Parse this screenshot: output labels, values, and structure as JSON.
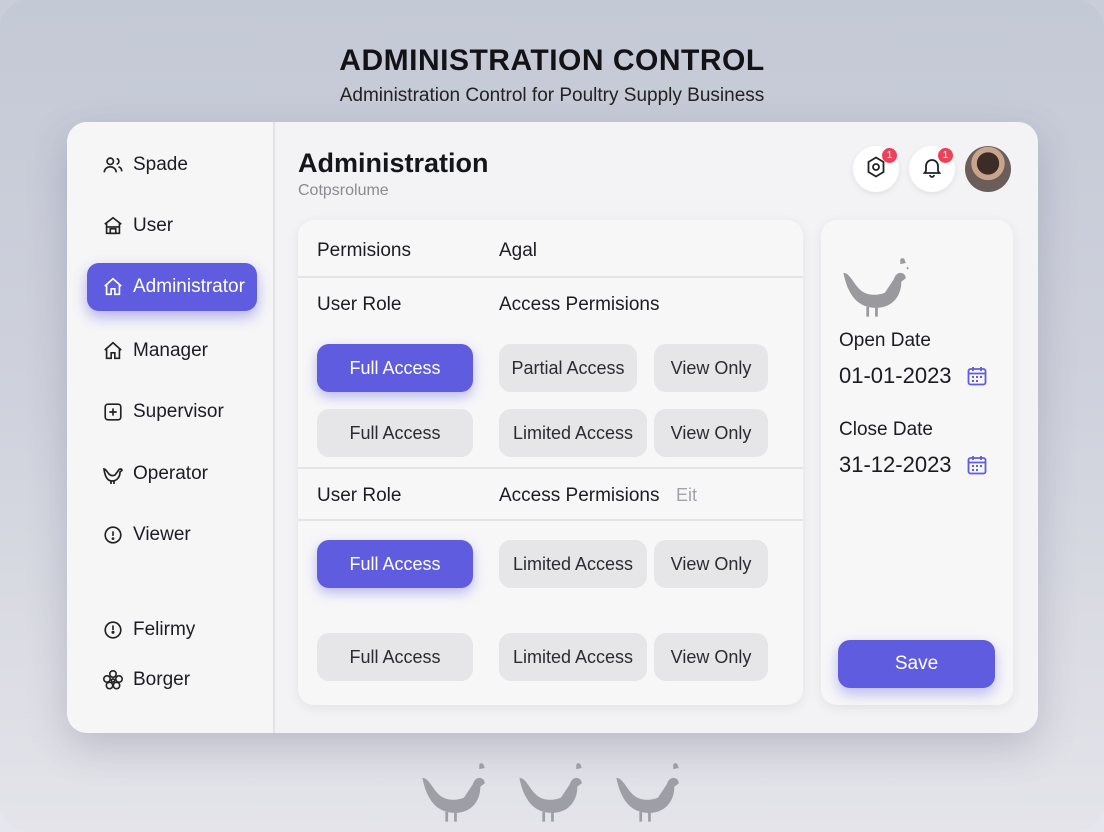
{
  "header": {
    "title": "ADMINISTRATION CONTROL",
    "subtitle": "Administration Control for Poultry Supply Business"
  },
  "sidebar": {
    "items": [
      {
        "label": "Spade",
        "icon": "users-icon"
      },
      {
        "label": "User",
        "icon": "store-icon"
      },
      {
        "label": "Administrator",
        "icon": "home-icon",
        "active": true
      },
      {
        "label": "Manager",
        "icon": "home-icon"
      },
      {
        "label": "Supervisor",
        "icon": "plus-square-icon"
      },
      {
        "label": "Operator",
        "icon": "hen-outline-icon"
      },
      {
        "label": "Viewer",
        "icon": "info-circle-icon"
      },
      {
        "label": "Felirmy",
        "icon": "clock-circle-icon"
      },
      {
        "label": "Borger",
        "icon": "flower-icon"
      }
    ]
  },
  "page": {
    "title": "Administration",
    "subtitle": "Cotpsrolume",
    "badge_count_1": "1",
    "badge_count_2": "1"
  },
  "permissions": {
    "col1_header": "Permisions",
    "col2_header": "Agal",
    "section1": {
      "role_header": "User Role",
      "access_header": "Access Permisions",
      "rows": [
        [
          "Full Access",
          "Partial Access",
          "View Only"
        ],
        [
          "Full Access",
          "Limited Access",
          "View Only"
        ]
      ]
    },
    "section2": {
      "role_header": "User Role",
      "access_header": "Access Permisions",
      "edit_label": "Eit",
      "rows": [
        [
          "Full Access",
          "Limited Access",
          "View Only"
        ],
        [
          "Full Access",
          "Limited Access",
          "View Only"
        ]
      ]
    }
  },
  "dates": {
    "open_label": "Open Date",
    "open_value": "01-01-2023",
    "close_label": "Close Date",
    "close_value": "31-12-2023",
    "save_label": "Save"
  },
  "colors": {
    "accent": "#5f5ce0",
    "badge": "#e8435a",
    "hen": "#9a9a9e"
  }
}
